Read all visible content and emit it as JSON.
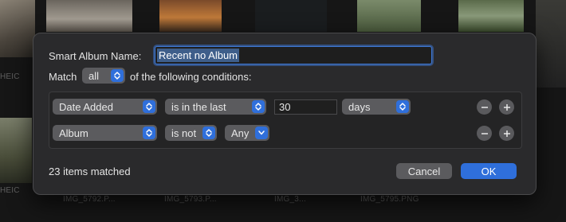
{
  "background": {
    "captions": [
      "HEIC",
      "HEIC",
      "IMG_5792.P...",
      "IMG_5793.P...",
      "IMG_3...",
      "IMG_5795.PNG"
    ]
  },
  "dialog": {
    "name_label": "Smart Album Name:",
    "name_value": "Recent no Album",
    "match_label": "Match",
    "match_value": "all",
    "match_suffix": "of the following conditions:",
    "rules": [
      {
        "field": "Date Added",
        "operator": "is in the last",
        "value": "30",
        "unit": "days"
      },
      {
        "field": "Album",
        "operator": "is not",
        "value": "Any"
      }
    ],
    "remove_symbol": "−",
    "add_symbol": "+",
    "status": "23 items matched",
    "cancel_label": "Cancel",
    "ok_label": "OK",
    "accent_color": "#2f6fdb"
  }
}
